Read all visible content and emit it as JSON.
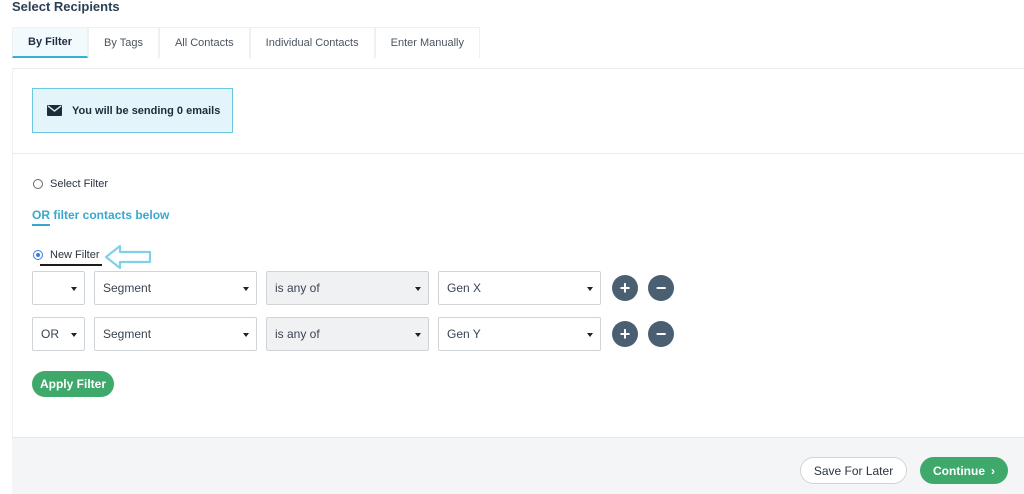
{
  "page": {
    "title": "Select Recipients"
  },
  "tabs": [
    {
      "label": "By Filter",
      "active": true
    },
    {
      "label": "By Tags",
      "active": false
    },
    {
      "label": "All Contacts",
      "active": false
    },
    {
      "label": "Individual Contacts",
      "active": false
    },
    {
      "label": "Enter Manually",
      "active": false
    }
  ],
  "notice": {
    "text": "You will be sending 0 emails",
    "icon": "envelope-icon"
  },
  "options": {
    "select_filter_label": "Select Filter",
    "or_filter_label": "OR filter contacts below",
    "new_filter_label": "New Filter"
  },
  "filters": [
    {
      "connector": "",
      "field": "Segment",
      "operator": "is any of",
      "value": "Gen X"
    },
    {
      "connector": "OR",
      "field": "Segment",
      "operator": "is any of",
      "value": "Gen Y"
    }
  ],
  "buttons": {
    "add_symbol": "+",
    "remove_symbol": "−",
    "apply_filter": "Apply Filter",
    "save_for_later": "Save For Later",
    "continue": "Continue",
    "continue_chevron": "›"
  },
  "colors": {
    "accent_blue": "#38a9cc",
    "green": "#3ea96b",
    "dark_button": "#4b5f73",
    "annotation_arrow": "#7fd0e8"
  }
}
